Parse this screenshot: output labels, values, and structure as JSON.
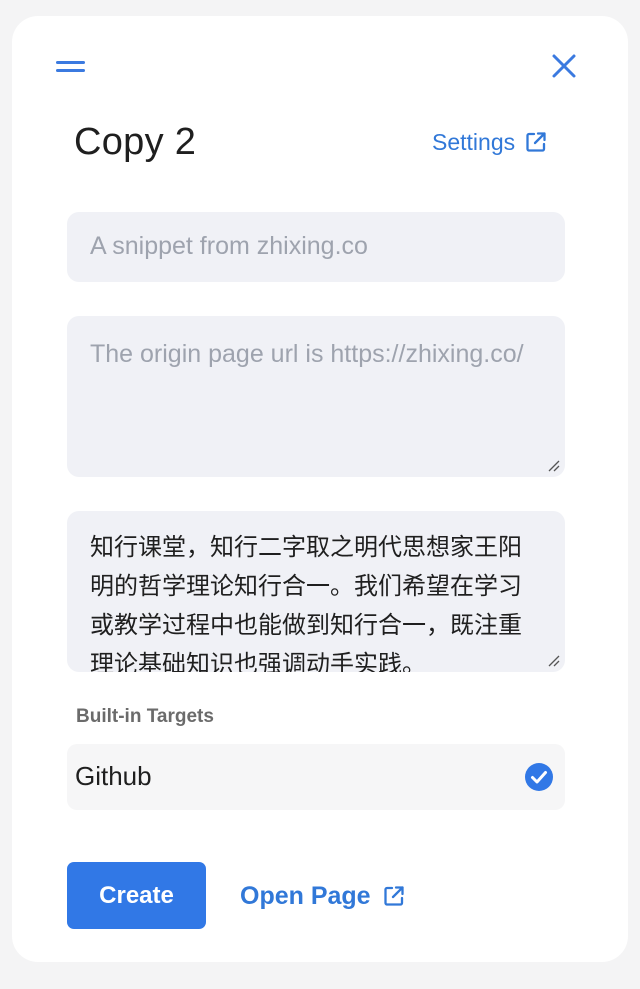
{
  "header": {
    "menu_icon": "hamburger-icon",
    "close_icon": "close-icon"
  },
  "title": "Copy 2",
  "settings": {
    "label": "Settings",
    "icon": "external-link-icon"
  },
  "form": {
    "snippet_placeholder": "A snippet from zhixing.co",
    "url_placeholder": "The origin page url is https://zhixing.co/",
    "content": "知行课堂，知行二字取之明代思想家王阳明的哲学理论知行合一。我们希望在学习或教学过程中也能做到知行合一，既注重理论基础知识也强调动手实践。"
  },
  "targets": {
    "section_label": "Built-in Targets",
    "items": [
      {
        "label": "Github",
        "checked": true
      }
    ]
  },
  "actions": {
    "create_label": "Create",
    "open_page_label": "Open Page",
    "open_page_icon": "external-link-icon"
  },
  "colors": {
    "accent": "#3178e6",
    "field_background": "#f0f1f6",
    "placeholder": "#9ea3ae"
  }
}
